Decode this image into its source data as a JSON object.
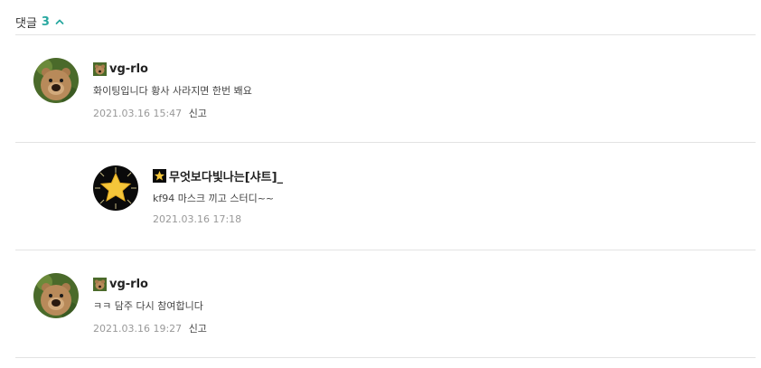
{
  "header": {
    "label": "댓글",
    "count": "3"
  },
  "comments": [
    {
      "author": "vg-rlo",
      "text": "화이팅입니다 황사 사라지면 한번 봬요",
      "timestamp": "2021.03.16 15:47",
      "report": "신고",
      "avatar": "bear-avatar",
      "badge": "bear-badge-icon"
    },
    {
      "author": "무엇보다빛나는[샤트]_",
      "text": "kf94 마스크 끼고 스터디~~",
      "timestamp": "2021.03.16 17:18",
      "avatar": "star-avatar",
      "badge": "star-badge-icon"
    },
    {
      "author": "vg-rlo",
      "text": "ㅋㅋ 담주 다시 참여합니다",
      "timestamp": "2021.03.16 19:27",
      "report": "신고",
      "avatar": "bear-avatar",
      "badge": "bear-badge-icon"
    }
  ],
  "colors": {
    "accent": "#28a8a0",
    "divider": "#e3e3e3",
    "meta": "#999999"
  }
}
